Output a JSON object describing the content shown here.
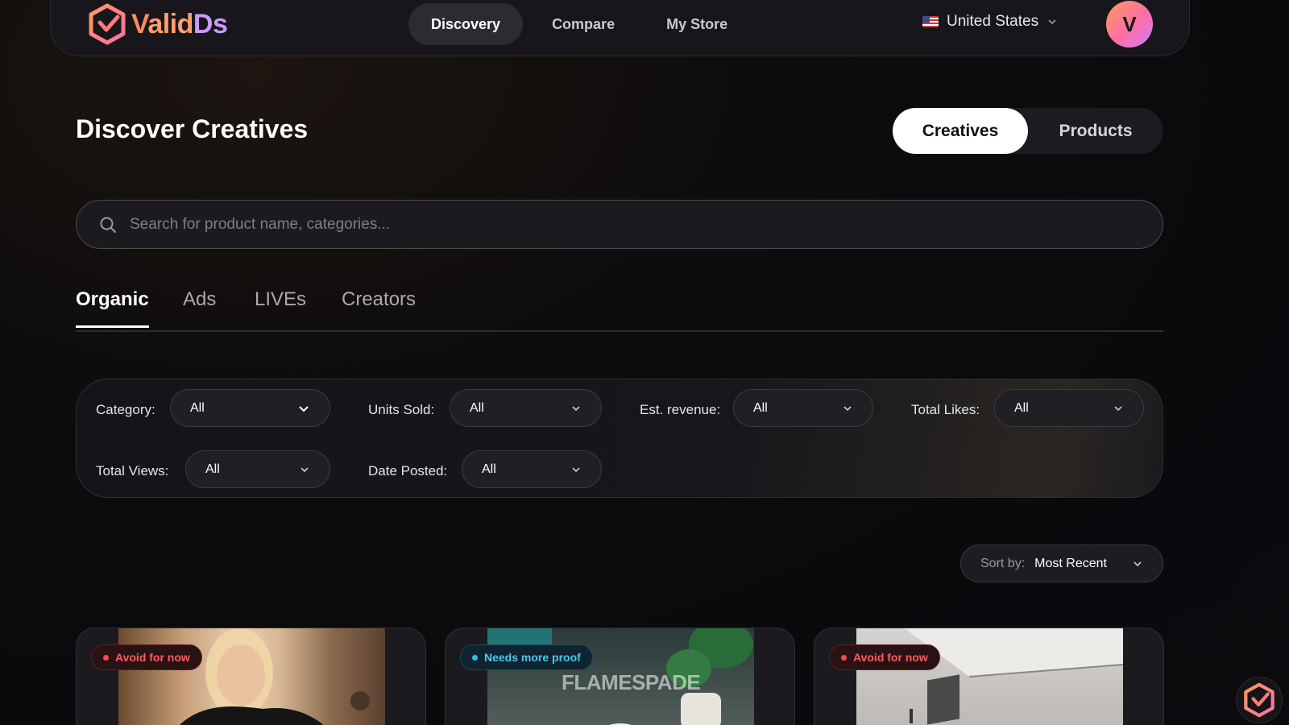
{
  "brand": {
    "name_v": "V",
    "name_alid": "alid",
    "name_ds": "Ds"
  },
  "nav": {
    "tabs": [
      {
        "label": "Discovery",
        "active": true
      },
      {
        "label": "Compare",
        "active": false
      },
      {
        "label": "My Store",
        "active": false
      }
    ],
    "country": "United States",
    "avatar_initial": "V"
  },
  "header": {
    "title": "Discover Creatives",
    "segments": [
      {
        "label": "Creatives",
        "active": true
      },
      {
        "label": "Products",
        "active": false
      }
    ]
  },
  "search": {
    "placeholder": "Search for product name, categories..."
  },
  "content_tabs": [
    {
      "label": "Organic",
      "active": true
    },
    {
      "label": "Ads",
      "active": false
    },
    {
      "label": "LIVEs",
      "active": false
    },
    {
      "label": "Creators",
      "active": false
    }
  ],
  "filters": {
    "category": {
      "label": "Category:",
      "value": "All"
    },
    "units_sold": {
      "label": "Units Sold:",
      "value": "All"
    },
    "est_revenue": {
      "label": "Est. revenue:",
      "value": "All"
    },
    "total_likes": {
      "label": "Total Likes:",
      "value": "All"
    },
    "total_views": {
      "label": "Total Views:",
      "value": "All"
    },
    "date_posted": {
      "label": "Date Posted:",
      "value": "All"
    }
  },
  "sort": {
    "label": "Sort by:",
    "value": "Most Recent"
  },
  "cards": [
    {
      "badge": "Avoid for now",
      "badge_type": "red"
    },
    {
      "badge": "Needs more proof",
      "badge_type": "blue",
      "watermark": "FLAMESPADE"
    },
    {
      "badge": "Avoid for now",
      "badge_type": "red"
    }
  ],
  "colors": {
    "accent_orange": "#ff8a5b",
    "accent_purple": "#c99bff",
    "badge_red": "#ff5a5f",
    "badge_blue": "#4ec6ea"
  }
}
